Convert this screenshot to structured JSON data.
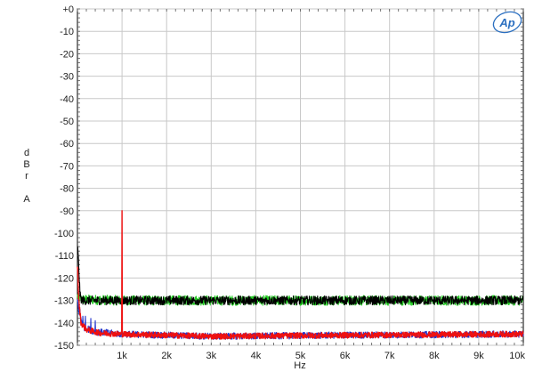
{
  "chart_data": {
    "type": "line",
    "title": "",
    "xlabel": "Hz",
    "ylabel_lines": [
      "d",
      "B",
      "r",
      "",
      "A"
    ],
    "xlim": [
      0,
      10000
    ],
    "ylim": [
      -150,
      0
    ],
    "x_ticks": [
      {
        "value": 1000,
        "label": "1k"
      },
      {
        "value": 2000,
        "label": "2k"
      },
      {
        "value": 3000,
        "label": "3k"
      },
      {
        "value": 4000,
        "label": "4k"
      },
      {
        "value": 5000,
        "label": "5k"
      },
      {
        "value": 6000,
        "label": "6k"
      },
      {
        "value": 7000,
        "label": "7k"
      },
      {
        "value": 8000,
        "label": "8k"
      },
      {
        "value": 9000,
        "label": "9k"
      },
      {
        "value": 10000,
        "label": "10k"
      }
    ],
    "y_ticks": [
      {
        "value": 0,
        "label": "+0"
      },
      {
        "value": -10,
        "label": "-10"
      },
      {
        "value": -20,
        "label": "-20"
      },
      {
        "value": -30,
        "label": "-30"
      },
      {
        "value": -40,
        "label": "-40"
      },
      {
        "value": -50,
        "label": "-50"
      },
      {
        "value": -60,
        "label": "-60"
      },
      {
        "value": -70,
        "label": "-70"
      },
      {
        "value": -80,
        "label": "-80"
      },
      {
        "value": -90,
        "label": "-90"
      },
      {
        "value": -100,
        "label": "-100"
      },
      {
        "value": -110,
        "label": "-110"
      },
      {
        "value": -120,
        "label": "-120"
      },
      {
        "value": -130,
        "label": "-130"
      },
      {
        "value": -140,
        "label": "-140"
      },
      {
        "value": -150,
        "label": "-150"
      }
    ],
    "grid": true,
    "series": [
      {
        "color": "#22cc22",
        "points": [
          [
            0,
            -128
          ],
          [
            50,
            -129.5
          ],
          [
            1000,
            -130
          ],
          [
            5000,
            -130
          ],
          [
            10000,
            -130
          ]
        ],
        "noise": 2.2
      },
      {
        "color": "#000000",
        "points": [
          [
            0,
            -105
          ],
          [
            30,
            -115
          ],
          [
            60,
            -128
          ],
          [
            100,
            -130
          ],
          [
            1000,
            -130
          ],
          [
            5000,
            -130
          ],
          [
            10000,
            -130
          ]
        ],
        "noise": 2.0
      },
      {
        "color": "#2233cc",
        "points": [
          [
            0,
            -130
          ],
          [
            40,
            -136
          ],
          [
            150,
            -142
          ],
          [
            400,
            -144
          ],
          [
            1000,
            -145
          ],
          [
            3000,
            -146
          ],
          [
            6000,
            -145.5
          ],
          [
            10000,
            -145
          ]
        ],
        "noise": 1.5,
        "spikes": [
          [
            60,
            -134
          ],
          [
            120,
            -137
          ],
          [
            180,
            -137
          ],
          [
            300,
            -138
          ],
          [
            400,
            -139
          ]
        ]
      },
      {
        "color": "#ee1111",
        "points": [
          [
            0,
            -114
          ],
          [
            30,
            -130
          ],
          [
            80,
            -140
          ],
          [
            200,
            -143
          ],
          [
            500,
            -144.5
          ],
          [
            1000,
            -145
          ],
          [
            3000,
            -146
          ],
          [
            6000,
            -145.5
          ],
          [
            10000,
            -145
          ]
        ],
        "noise": 1.3,
        "spikes": [
          [
            1000,
            -90
          ]
        ]
      }
    ]
  },
  "logo": {
    "text": "Ap",
    "color": "#2b6fc0"
  }
}
